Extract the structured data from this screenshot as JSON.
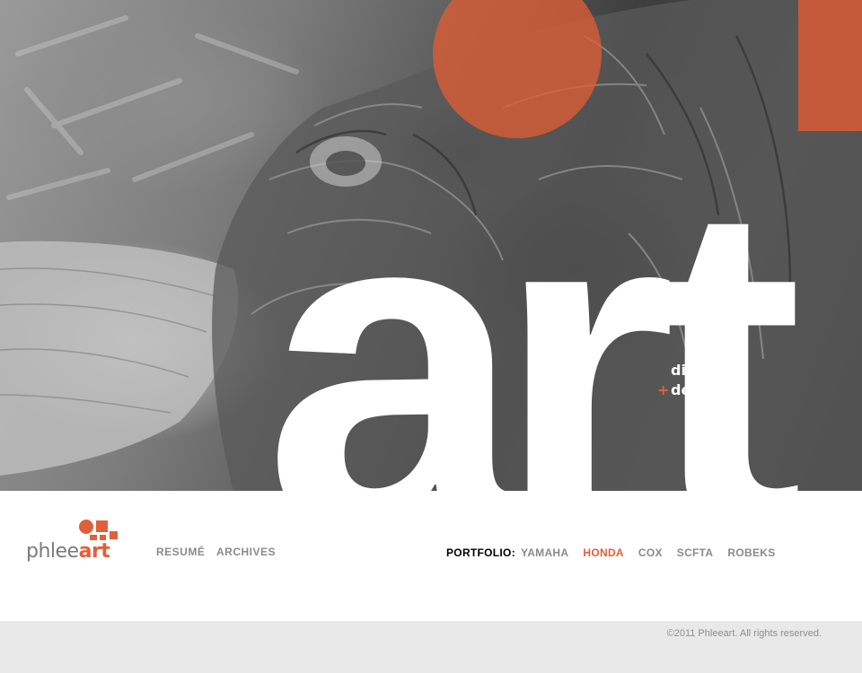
{
  "hero": {
    "headline": "art",
    "tagline_line1": "direction",
    "tagline_plus": "+",
    "tagline_line2": "design"
  },
  "logo": {
    "text_light": "phlee",
    "text_bold": "art",
    "accent": "#e0603a"
  },
  "nav": {
    "resume": "RESUMÉ",
    "archives": "ARCHIVES",
    "portfolio_label": "PORTFOLIO:",
    "portfolio_items": [
      {
        "label": "YAMAHA",
        "active": false
      },
      {
        "label": "HONDA",
        "active": true
      },
      {
        "label": "COX",
        "active": false
      },
      {
        "label": "SCFTA",
        "active": false
      },
      {
        "label": "ROBEKS",
        "active": false
      }
    ]
  },
  "footer": {
    "copyright": "©2011 Phleeart. All rights reserved."
  },
  "colors": {
    "accent": "#e0603a",
    "nav_text": "#8a8a8a",
    "footer_bg": "#e9e9e9"
  }
}
